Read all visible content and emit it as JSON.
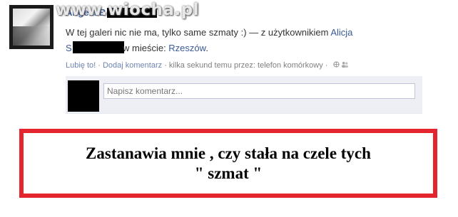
{
  "watermark": "www.wiocha.pl",
  "post": {
    "author_prefix": "Angela B",
    "text": "W tej galeri nic nie ma, tylko same szmaty :)",
    "with_sep": " — z użytkownikiem ",
    "tagged_first": "Alicja",
    "tagged_initial": "S",
    "location_prefix": "w mieście: ",
    "location": "Rzeszów",
    "location_suffix": "."
  },
  "actions": {
    "like": "Lubię to!",
    "sep1": " · ",
    "comment": "Dodaj komentarz",
    "sep2": " · ",
    "time": "kilka sekund temu przez: telefon komórkowy",
    "sep3": " · "
  },
  "comment_box": {
    "placeholder": "Napisz komentarz..."
  },
  "notice": {
    "line1": "Zastanawia mnie , czy stała na czele tych",
    "line2": "\" szmat \""
  },
  "colors": {
    "link": "#3b5998",
    "meta_link": "#6d84b4",
    "frame": "#e4252d"
  },
  "icons": {
    "privacy": "globe-icon",
    "audience": "people-icon"
  }
}
